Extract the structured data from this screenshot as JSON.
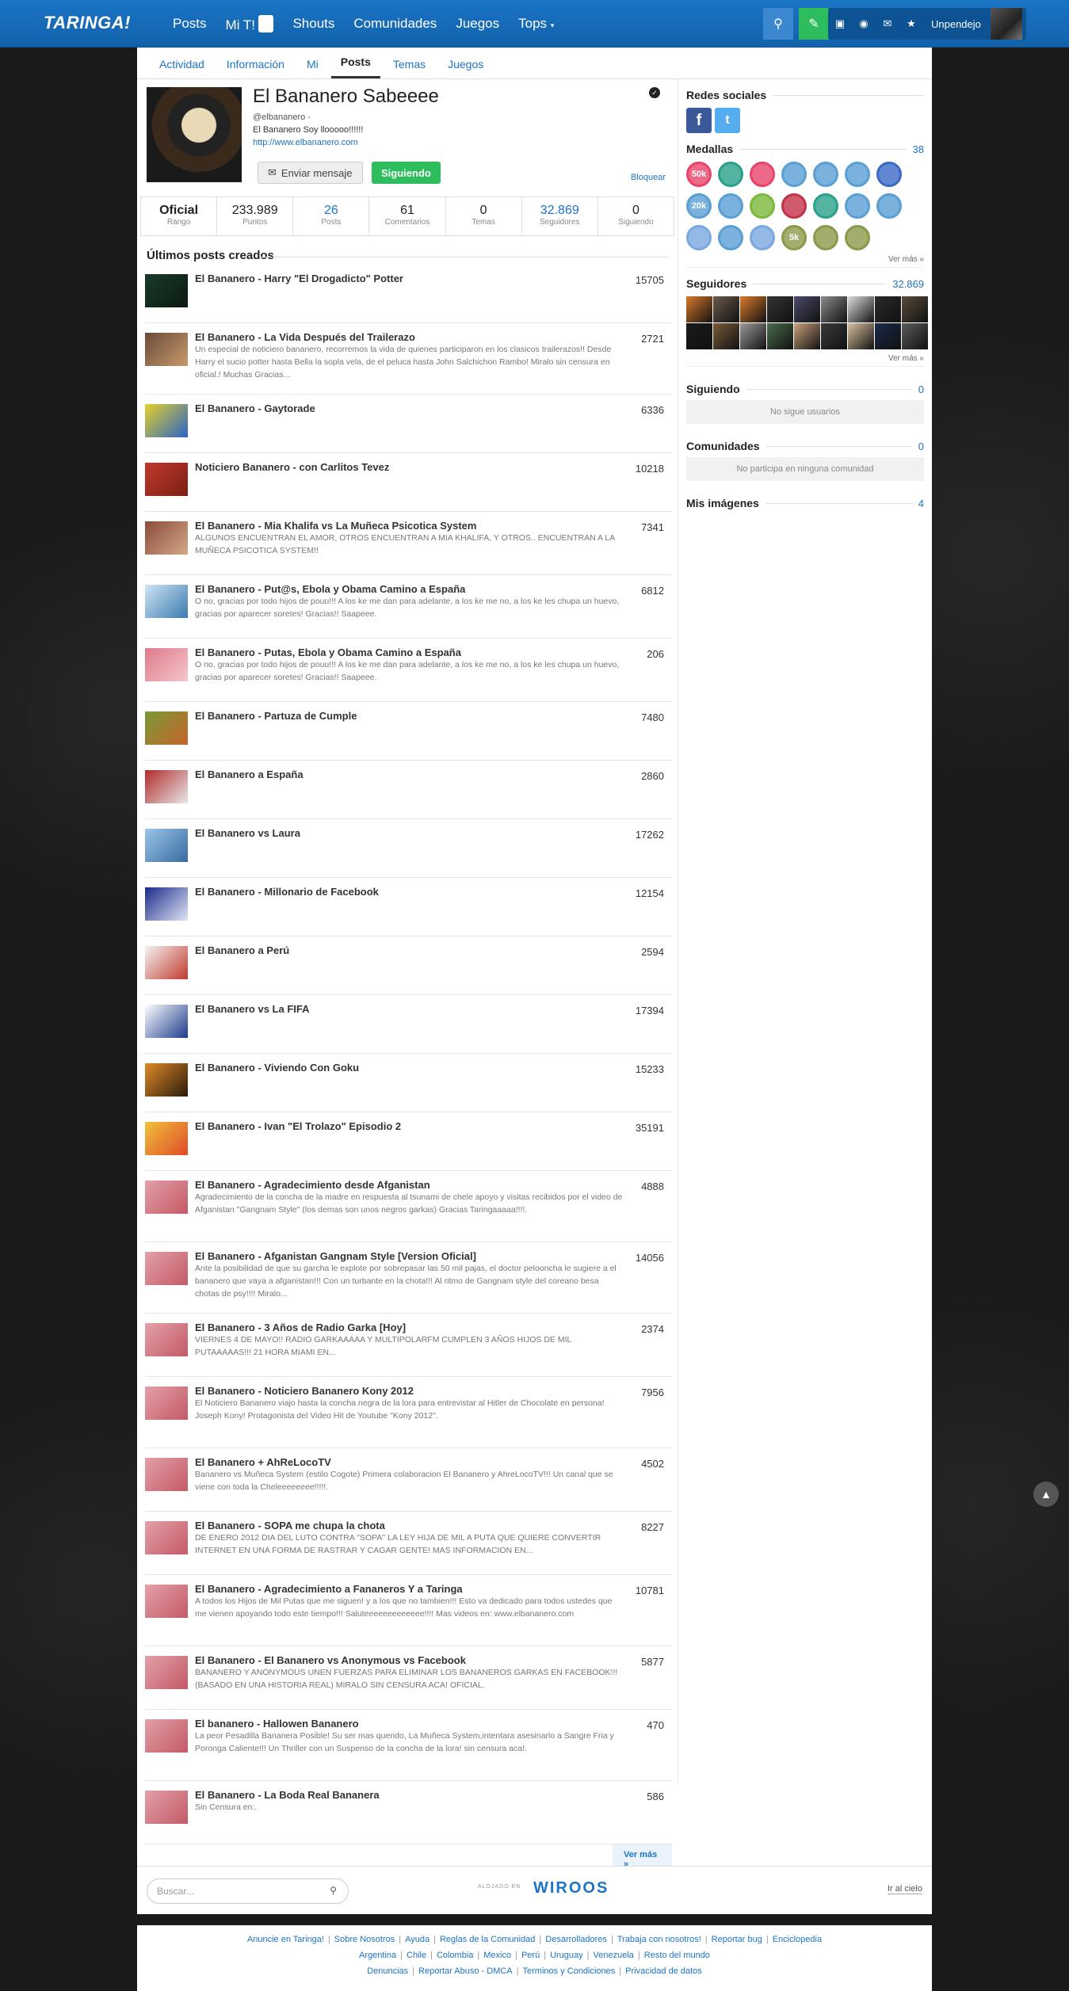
{
  "topbar": {
    "logo": "TARINGA!",
    "nav": [
      "Posts",
      "Mi T!",
      "Shouts",
      "Comunidades",
      "Juegos",
      "Tops"
    ],
    "mit_badge": "1",
    "username": "Unpendejo",
    "accent": "#1262ab"
  },
  "subnav": [
    "Actividad",
    "Información",
    "Mi",
    "Posts",
    "Temas",
    "Juegos"
  ],
  "profile": {
    "name": "El Bananero Sabeeee",
    "handle": "@elbananero -",
    "bio": "El Bananero Soy llooooo!!!!!!",
    "url": "http://www.elbananero.com",
    "send_message": "Enviar mensaje",
    "following_btn": "Siguiendo",
    "block": "Bloquear"
  },
  "stats": [
    {
      "v": "Oficial",
      "l": "Rango"
    },
    {
      "v": "233.989",
      "l": "Puntos"
    },
    {
      "v": "26",
      "l": "Posts"
    },
    {
      "v": "61",
      "l": "Comentarios"
    },
    {
      "v": "0",
      "l": "Temas"
    },
    {
      "v": "32.869",
      "l": "Seguidores"
    },
    {
      "v": "0",
      "l": "Siguiendo"
    }
  ],
  "posts_title": "Últimos posts creados",
  "posts": [
    {
      "t": "El Bananero - Harry \"El Drogadicto\" Potter",
      "p": "15705",
      "d": ""
    },
    {
      "t": "El Bananero - La Vida Después del Trailerazo",
      "p": "2721",
      "d": "Un especial de noticiero bananero, recorremos la vida de quienes participaron en los clasicos trailerazos!! Desde Harry el sucio potter hasta Bella la sopla vela, de el peluca hasta John Salchichon Rambo! Miralo sin censura en oficial.! Muchas Gracias..."
    },
    {
      "t": "El Bananero - Gaytorade",
      "p": "6336",
      "d": ""
    },
    {
      "t": "Noticiero Bananero - con Carlitos Tevez",
      "p": "10218",
      "d": ""
    },
    {
      "t": "El Bananero - Mia Khalifa vs La Muñeca Psicotica System",
      "p": "7341",
      "d": "ALGUNOS ENCUENTRAN EL AMOR, OTROS ENCUENTRAN A MIA KHALIFA, Y OTROS.. ENCUENTRAN A LA MUÑECA PSICOTICA SYSTEM!!"
    },
    {
      "t": "El Bananero - Put@s, Ebola y Obama Camino a España",
      "p": "6812",
      "d": "O no, gracias por todo hijos de pouu!!! A los ke me dan para adelante, a los ke me no, a los ke les chupa un huevo, gracias por aparecer soretes! Gracias!! Saapeee."
    },
    {
      "t": "El Bananero - Putas, Ebola y Obama Camino a España",
      "p": "206",
      "d": "O no, gracias por todo hijos de pouu!!! A los ke me dan para adelante, a los ke me no, a los ke les chupa un huevo, gracias por aparecer soretes! Gracias!! Saapeee."
    },
    {
      "t": "El Bananero - Partuza de Cumple",
      "p": "7480",
      "d": ""
    },
    {
      "t": "El Bananero a España",
      "p": "2860",
      "d": ""
    },
    {
      "t": "El Bananero vs Laura",
      "p": "17262",
      "d": ""
    },
    {
      "t": "El Bananero - Millonario de Facebook",
      "p": "12154",
      "d": ""
    },
    {
      "t": "El Bananero a Perú",
      "p": "2594",
      "d": ""
    },
    {
      "t": "El Bananero vs La FIFA",
      "p": "17394",
      "d": ""
    },
    {
      "t": "El Bananero - Viviendo Con Goku",
      "p": "15233",
      "d": ""
    },
    {
      "t": "El Bananero - Ivan \"El Trolazo\" Episodio 2",
      "p": "35191",
      "d": ""
    },
    {
      "t": "El Bananero - Agradecimiento desde Afganistan",
      "p": "4888",
      "d": "Agradecimiento de la concha de la madre en respuesta al tsunami de chele apoyo y visitas recibidos por el video de Afganistan \"Gangnam Style\" (los demas son unos negros garkas) Gracias Taringaaaaa!!!!."
    },
    {
      "t": "El Bananero - Afganistan Gangnam Style [Version Oficial]",
      "p": "14056",
      "d": "Ante la posibilidad de que su garcha le explote por sobrepasar las 50 mil pajas, el doctor pelooncha le sugiere a el bananero que vaya a afganistan!!! Con un turbante en la chota!!! Al ritmo de Gangnam style del coreano besa chotas de psy!!!! Miralo..."
    },
    {
      "t": "El Bananero - 3 Años de Radio Garka [Hoy]",
      "p": "2374",
      "d": "VIERNES 4 DE MAYO!! RADIO GARKAAAAA Y MULTIPOLARFM CUMPLEN 3 AÑOS HIJOS DE MIL PUTAAAAAS!!! 21 HORA MIAMI EN..."
    },
    {
      "t": "El Bananero - Noticiero Bananero Kony 2012",
      "p": "7956",
      "d": "El Noticiero Bananero viajo hasta la concha negra de la lora para entrevistar al Hitler de Chocolate en persona! Joseph Kony! Protagonista del Video Hit de Youtube \"Kony 2012\"."
    },
    {
      "t": "El Bananero + AhReLocoTV",
      "p": "4502",
      "d": "Bananero vs Muñeca System (estilo Cogote) Primera colaboracion El Bananero y AhreLocoTV!!! Un canal que se viene con toda la Cheleeeeeeee!!!!!."
    },
    {
      "t": "El Bananero - SOPA me chupa la chota",
      "p": "8227",
      "d": "DE ENERO 2012 DIA DEL LUTO CONTRA \"SOPA\" LA LEY HIJA DE MIL A PUTA QUE QUIERE CONVERTIR INTERNET EN UNA FORMA DE RASTRAR Y CAGAR GENTE! MAS INFORMACION EN..."
    },
    {
      "t": "El Bananero - Agradecimiento a Fananeros Y a Taringa",
      "p": "10781",
      "d": "A todos los Hijos de Mil Putas que me siguen! y a los que no tambien!!! Esto va dedicado para todos ustedes que me vienen apoyando todo este tiempo!!! Saluteeeeeeeeeeeee!!!! Mas videos en: www.elbananero.com"
    },
    {
      "t": "El Bananero - El Bananero vs Anonymous vs Facebook",
      "p": "5877",
      "d": "BANANERO Y ANONYMOUS UNEN FUERZAS PARA ELIMINAR LOS BANANEROS GARKAS EN FACEBOOK!!! (BASADO EN UNA HISTORIA REAL) MIRALO SIN CENSURA ACA! OFICIAL."
    },
    {
      "t": "El bananero - Hallowen Bananero",
      "p": "470",
      "d": "La peor Pesadilla Bananera Posible! Su ser mas querido, La Muñeca System,intentara asesinarlo a Sangre Fria y Poronga Caliente!!! Un Thriller con un Suspenso de la concha de la lora! sin censura aca!."
    },
    {
      "t": "El Bananero - La Boda Real Bananera",
      "p": "586",
      "d": "Sin Censura en:."
    }
  ],
  "posts_more": "Ver más »",
  "right": {
    "social_title": "Redes sociales",
    "medals_title": "Medallas",
    "medals_count": "38",
    "medals_more": "Ver más »",
    "medals": [
      "50k",
      "",
      "",
      "",
      "",
      "",
      "",
      "20k",
      "",
      "",
      "",
      "",
      "",
      "",
      "",
      "",
      "",
      "5k",
      "",
      ""
    ],
    "followers_title": "Seguidores",
    "followers_count": "32.869",
    "followers_more": "Ver más »",
    "following_title": "Siguiendo",
    "following_count": "0",
    "following_empty": "No sigue usuarios",
    "communities_title": "Comunidades",
    "communities_count": "0",
    "communities_empty": "No participa en ninguna comunidad",
    "images_title": "Mis imágenes",
    "images_count": "4"
  },
  "footbar": {
    "search_placeholder": "Buscar...",
    "hosted": "ALOJADO EN",
    "host": "WIROOS",
    "go_top": "Ir al cielo"
  },
  "footer": {
    "row1": [
      "Anuncie en Taringa!",
      "Sobre Nosotros",
      "Ayuda",
      "Reglas de la Comunidad",
      "Desarrolladores",
      "Trabaja con nosotros!",
      "Reportar bug",
      "Enciclopedia"
    ],
    "row2": [
      "Argentina",
      "Chile",
      "Colombia",
      "Mexico",
      "Perú",
      "Uruguay",
      "Venezuela",
      "Resto del mundo"
    ],
    "row3": [
      "Denuncias",
      "Reportar Abuso - DMCA",
      "Terminos y Condiciones",
      "Privacidad de datos"
    ]
  }
}
